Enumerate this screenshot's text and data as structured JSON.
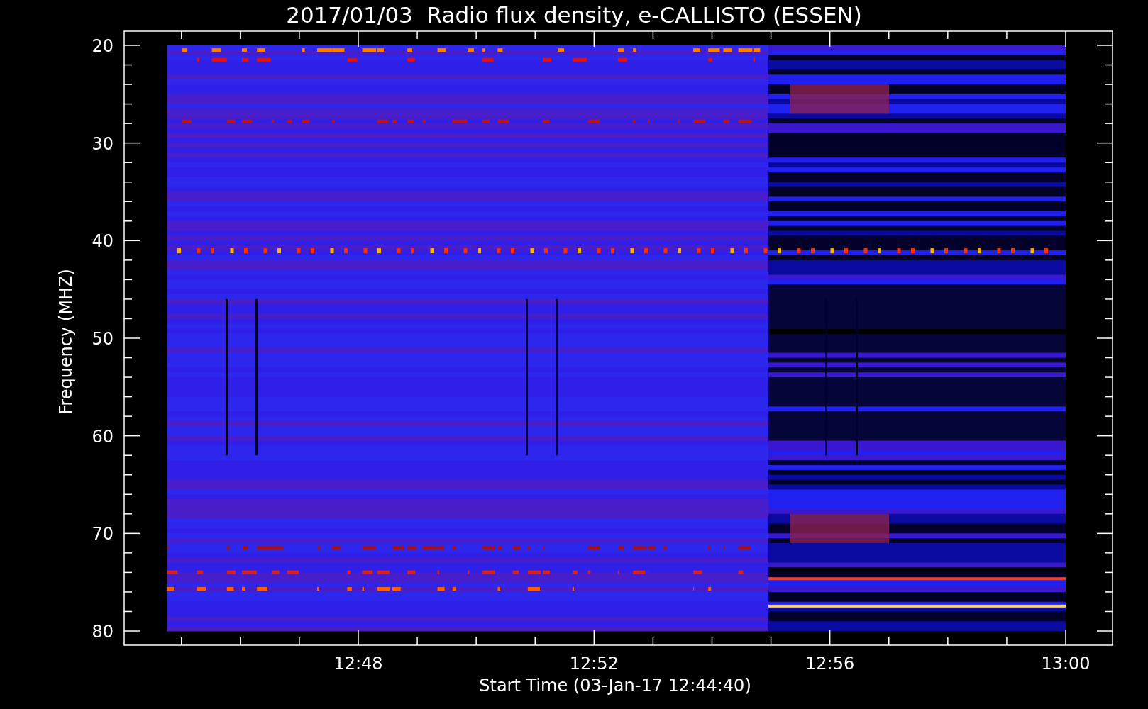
{
  "title": "2017/01/03  Radio flux density, e-CALLISTO (ESSEN)",
  "y_axis": {
    "label": "Frequency (MHZ)",
    "ticks": [
      "20",
      "30",
      "40",
      "50",
      "60",
      "70",
      "80"
    ]
  },
  "x_axis": {
    "label": "Start Time (03-Jan-17 12:44:40)",
    "ticks": [
      "12:48",
      "12:52",
      "12:56",
      "13:00"
    ]
  }
}
